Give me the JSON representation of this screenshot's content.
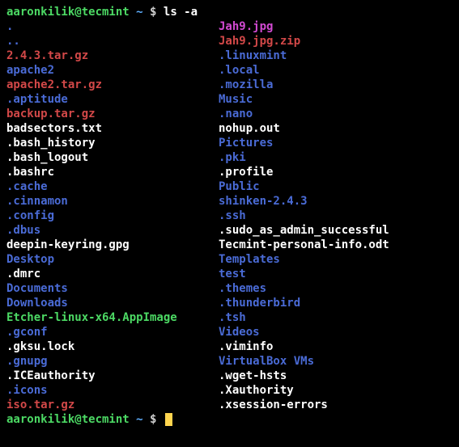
{
  "prompt": {
    "user": "aaronkilik@tecmint",
    "sep": " ",
    "tilde": "~",
    "dollar": " $ "
  },
  "command": "ls -a",
  "listing": [
    {
      "l": ".",
      "lc": "c-blue",
      "r": "Jah9.jpg",
      "rc": "c-magenta"
    },
    {
      "l": "..",
      "lc": "c-blue",
      "r": "Jah9.jpg.zip",
      "rc": "c-red"
    },
    {
      "l": "2.4.3.tar.gz",
      "lc": "c-red",
      "r": ".linuxmint",
      "rc": "c-blue"
    },
    {
      "l": "apache2",
      "lc": "c-blue",
      "r": ".local",
      "rc": "c-blue"
    },
    {
      "l": "apache2.tar.gz",
      "lc": "c-red",
      "r": ".mozilla",
      "rc": "c-blue"
    },
    {
      "l": ".aptitude",
      "lc": "c-blue",
      "r": "Music",
      "rc": "c-blue"
    },
    {
      "l": "backup.tar.gz",
      "lc": "c-red",
      "r": ".nano",
      "rc": "c-blue"
    },
    {
      "l": "badsectors.txt",
      "lc": "c-white",
      "r": "nohup.out",
      "rc": "c-white"
    },
    {
      "l": ".bash_history",
      "lc": "c-white",
      "r": "Pictures",
      "rc": "c-blue"
    },
    {
      "l": ".bash_logout",
      "lc": "c-white",
      "r": ".pki",
      "rc": "c-blue"
    },
    {
      "l": ".bashrc",
      "lc": "c-white",
      "r": ".profile",
      "rc": "c-white"
    },
    {
      "l": ".cache",
      "lc": "c-blue",
      "r": "Public",
      "rc": "c-blue"
    },
    {
      "l": ".cinnamon",
      "lc": "c-blue",
      "r": "shinken-2.4.3",
      "rc": "c-blue"
    },
    {
      "l": ".config",
      "lc": "c-blue",
      "r": ".ssh",
      "rc": "c-blue"
    },
    {
      "l": ".dbus",
      "lc": "c-blue",
      "r": ".sudo_as_admin_successful",
      "rc": "c-white"
    },
    {
      "l": "deepin-keyring.gpg",
      "lc": "c-white",
      "r": "Tecmint-personal-info.odt",
      "rc": "c-white"
    },
    {
      "l": "Desktop",
      "lc": "c-blue",
      "r": "Templates",
      "rc": "c-blue"
    },
    {
      "l": ".dmrc",
      "lc": "c-white",
      "r": "test",
      "rc": "c-blue"
    },
    {
      "l": "Documents",
      "lc": "c-blue",
      "r": ".themes",
      "rc": "c-blue"
    },
    {
      "l": "Downloads",
      "lc": "c-blue",
      "r": ".thunderbird",
      "rc": "c-blue"
    },
    {
      "l": "Etcher-linux-x64.AppImage",
      "lc": "c-green",
      "r": ".tsh",
      "rc": "c-blue"
    },
    {
      "l": ".gconf",
      "lc": "c-blue",
      "r": "Videos",
      "rc": "c-blue"
    },
    {
      "l": ".gksu.lock",
      "lc": "c-white",
      "r": ".viminfo",
      "rc": "c-white"
    },
    {
      "l": ".gnupg",
      "lc": "c-blue",
      "r": "VirtualBox VMs",
      "rc": "c-blue"
    },
    {
      "l": ".ICEauthority",
      "lc": "c-white",
      "r": ".wget-hsts",
      "rc": "c-white"
    },
    {
      "l": ".icons",
      "lc": "c-blue",
      "r": ".Xauthority",
      "rc": "c-white"
    },
    {
      "l": "iso.tar.gz",
      "lc": "c-red",
      "r": ".xsession-errors",
      "rc": "c-white"
    }
  ],
  "colors": {
    "directory": "#4a6bd6",
    "archive": "#d24848",
    "executable": "#4cd964",
    "regular": "#ffffff",
    "image": "#d24ad2",
    "symlink": "#40d0d0",
    "prompt_user": "#4cd964",
    "prompt_path": "#5fafff",
    "background": "#000000",
    "cursor": "#ffd54f"
  }
}
